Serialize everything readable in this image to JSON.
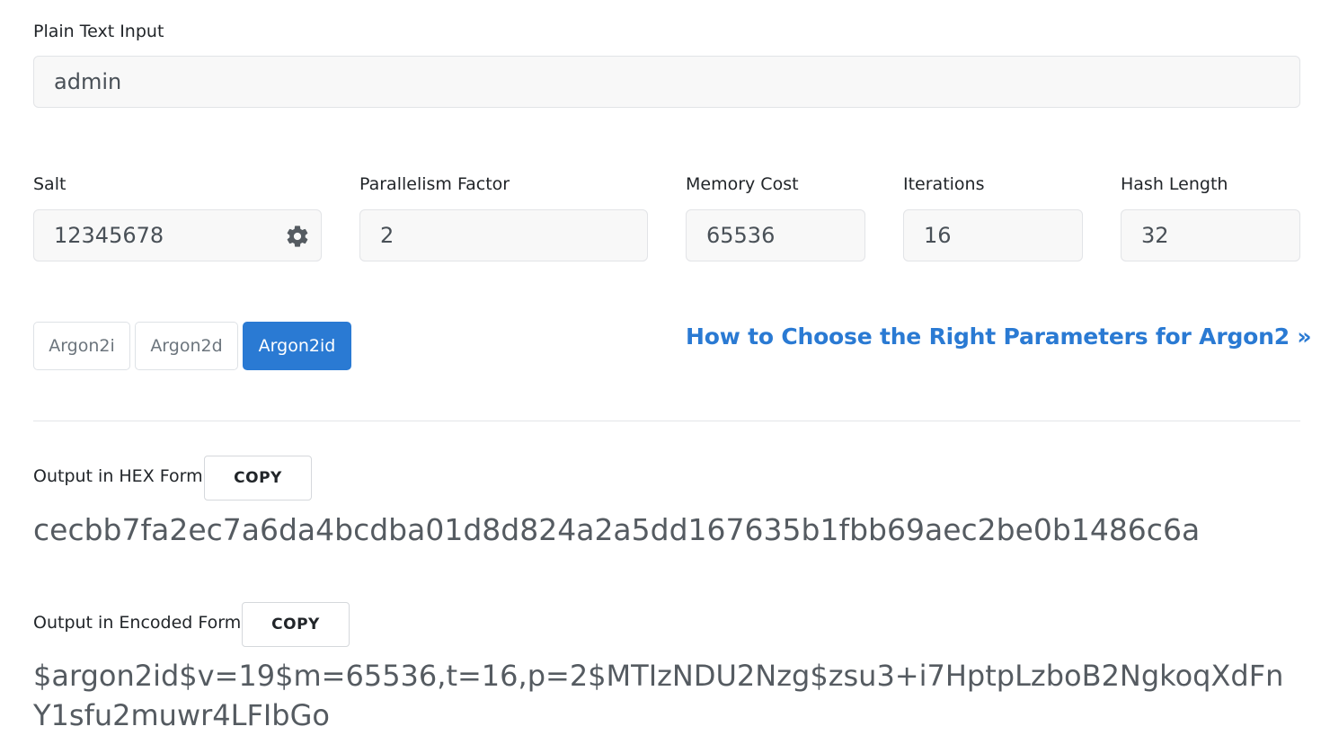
{
  "plain_text": {
    "label": "Plain Text Input",
    "value": "admin"
  },
  "params": {
    "salt": {
      "label": "Salt",
      "value": "12345678",
      "icon": "gear-icon"
    },
    "parallelism": {
      "label": "Parallelism Factor",
      "value": "2"
    },
    "memory": {
      "label": "Memory Cost",
      "value": "65536"
    },
    "iterations": {
      "label": "Iterations",
      "value": "16"
    },
    "hash_length": {
      "label": "Hash Length",
      "value": "32"
    }
  },
  "algorithms": {
    "options": [
      "Argon2i",
      "Argon2d",
      "Argon2id"
    ],
    "selected": "Argon2id",
    "active_color": "#2a7ad3"
  },
  "help_link": {
    "text": "How to Choose the Right Parameters for Argon2 »"
  },
  "output_hex": {
    "label": "Output in HEX Form",
    "copy_label": "COPY",
    "value": "cecbb7fa2ec7a6da4bcdba01d8d824a2a5dd167635b1fbb69aec2be0b1486c6a"
  },
  "output_encoded": {
    "label": "Output in Encoded Form",
    "copy_label": "COPY",
    "value": "$argon2id$v=19$m=65536,t=16,p=2$MTIzNDU2Nzg$zsu3+i7HptpLzboB2NgkoqXdFnY1sfu2muwr4LFIbGo"
  }
}
